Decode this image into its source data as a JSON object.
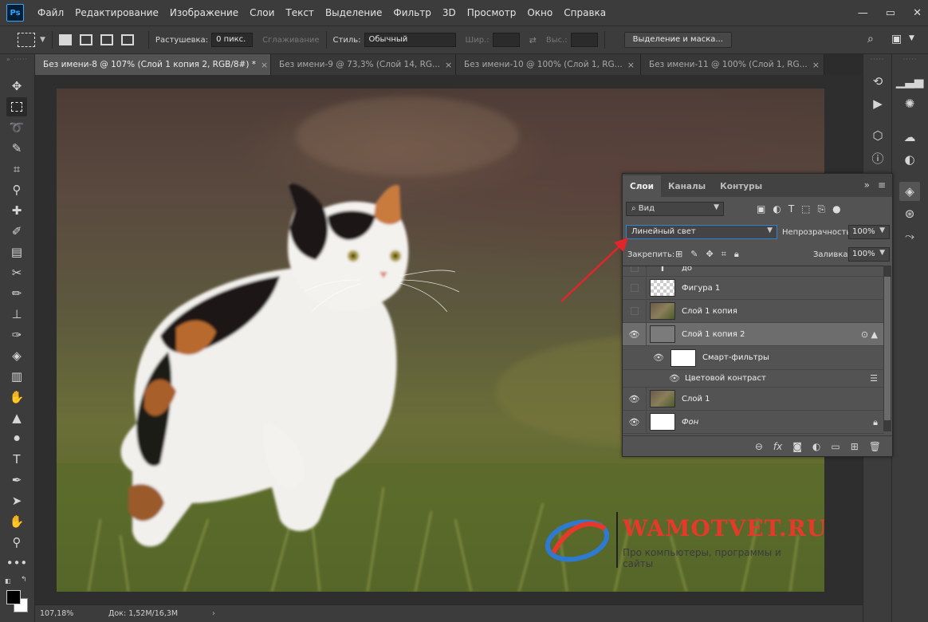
{
  "app": {
    "logo": "Ps"
  },
  "menu": [
    "Файл",
    "Редактирование",
    "Изображение",
    "Слои",
    "Текст",
    "Выделение",
    "Фильтр",
    "3D",
    "Просмотр",
    "Окно",
    "Справка"
  ],
  "window_controls": {
    "minimize": "—",
    "restore": "▭",
    "close": "✕"
  },
  "options": {
    "feather_label": "Растушевка:",
    "feather_value": "0 пикс.",
    "antialias_label": "Сглаживание",
    "style_label": "Стиль:",
    "style_value": "Обычный",
    "width_label": "Шир.:",
    "height_label": "Выс.:",
    "select_mask_button": "Выделение и маска..."
  },
  "tabs": [
    {
      "title": "Без имени-8 @ 107% (Слой 1 копия 2, RGB/8#) *",
      "close": "×"
    },
    {
      "title": "Без имени-9 @ 73,3% (Слой 14, RG...",
      "close": "×"
    },
    {
      "title": "Без имени-10 @ 100% (Слой 1, RG...",
      "close": "×"
    },
    {
      "title": "Без имени-11 @ 100% (Слой 1, RG...",
      "close": "×"
    }
  ],
  "layers_panel": {
    "tabs": [
      "Слои",
      "Каналы",
      "Контуры"
    ],
    "collapse": "»",
    "menu": "≡",
    "filter_kind": "Вид",
    "blend_mode": "Линейный свет",
    "opacity_label": "Непрозрачность:",
    "opacity_value": "100%",
    "lock_label": "Закрепить:",
    "fill_label": "Заливка:",
    "fill_value": "100%",
    "layers": [
      {
        "name": "до",
        "type": "text",
        "visible": false
      },
      {
        "name": "Фигура 1",
        "type": "shape",
        "visible": false
      },
      {
        "name": "Слой 1 копия",
        "type": "photo",
        "visible": false
      },
      {
        "name": "Слой 1 копия 2",
        "type": "smart",
        "visible": true,
        "selected": true
      },
      {
        "name": "Смарт-фильтры",
        "type": "filters",
        "visible": true
      },
      {
        "name": "Цветовой контраст",
        "type": "filter",
        "visible": true
      },
      {
        "name": "Слой 1",
        "type": "photo",
        "visible": true
      },
      {
        "name": "Фон",
        "type": "background",
        "visible": true,
        "locked": true
      }
    ]
  },
  "watermark": {
    "title": "WAMOTVET.RU",
    "subtitle": "Про компьютеры, программы и сайты"
  },
  "status": {
    "zoom": "107,18%",
    "doc": "Док: 1,52M/16,3M",
    "arrow": "›"
  },
  "colors": {
    "accent": "#31a8ff",
    "arrow": "#e0262a",
    "watermark": "#e53a2a"
  }
}
